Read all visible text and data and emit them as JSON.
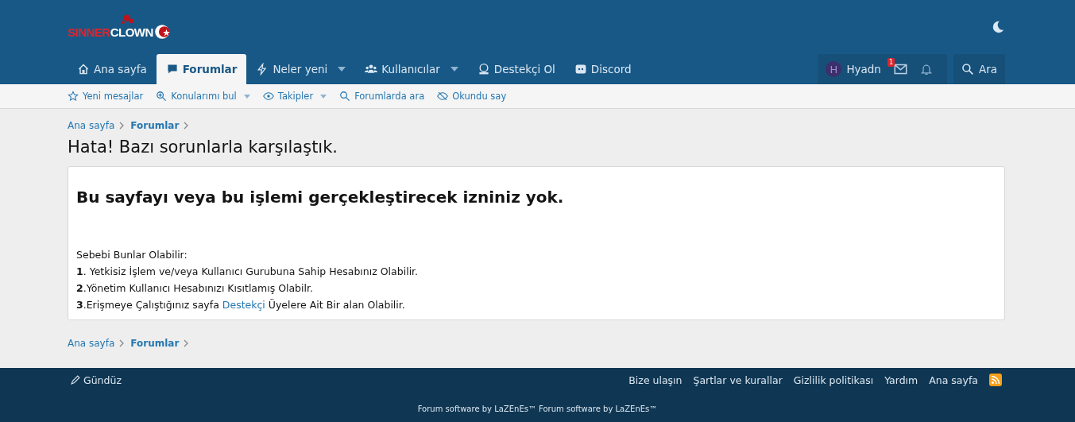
{
  "logo": {
    "part_1": "SINNER",
    "part_2": "CLOWN"
  },
  "nav": [
    {
      "label": "Ana sayfa",
      "selected": false,
      "dropdown": false
    },
    {
      "label": "Forumlar",
      "selected": true,
      "dropdown": false
    },
    {
      "label": "Neler yeni",
      "selected": false,
      "dropdown": true
    },
    {
      "label": "Kullanıcılar",
      "selected": false,
      "dropdown": true
    },
    {
      "label": "Destekçi Ol",
      "selected": false,
      "dropdown": false
    },
    {
      "label": "Discord",
      "selected": false,
      "dropdown": false
    }
  ],
  "user": {
    "avatar_letter": "H",
    "name": "Hyadn",
    "inbox_badge": "1"
  },
  "search_label": "Ara",
  "subnav": [
    {
      "label": "Yeni mesajlar",
      "dropdown": false
    },
    {
      "label": "Konularımı bul",
      "dropdown": true
    },
    {
      "label": "Takipler",
      "dropdown": true
    },
    {
      "label": "Forumlarda ara",
      "dropdown": false
    },
    {
      "label": "Okundu say",
      "dropdown": false
    }
  ],
  "breadcrumb_top": [
    {
      "label": "Ana sayfa",
      "current": false
    },
    {
      "label": "Forumlar",
      "current": true
    }
  ],
  "page_title": "Hata! Bazı sorunlarla karşılaştık.",
  "error": {
    "heading": "Bu sayfayı veya bu işlemi gerçekleştirecek izniniz yok.",
    "intro": "Sebebi Bunlar Olabilir:",
    "reasons": [
      {
        "kind": "plain",
        "text": "**1**. Yetkisiz İşlem ve/veya Kullanıcı Gurubuna Sahip Hesabınız Olabilir."
      },
      {
        "kind": "plain",
        "text": "**2**.Yönetim Kullanıcı Hesabınızı Kısıtlamış Olabilr."
      },
      {
        "kind": "link",
        "text": "**3**.Erişmeye Çalıştığınız sayfa",
        "link": "Destekçi",
        "after": "Üyelere Ait Bir alan Olabilir."
      }
    ]
  },
  "breadcrumb_bottom": [
    {
      "label": "Ana sayfa",
      "current": false
    },
    {
      "label": "Forumlar",
      "current": true
    }
  ],
  "footer": {
    "style_label": "Gündüz",
    "links": [
      "Bize ulaşın",
      "Şartlar ve kurallar",
      "Gizlilik politikası",
      "Yardım",
      "Ana sayfa"
    ],
    "copyright": "Forum software by LaZEnEs™ Forum software by LaZEnEs™"
  }
}
